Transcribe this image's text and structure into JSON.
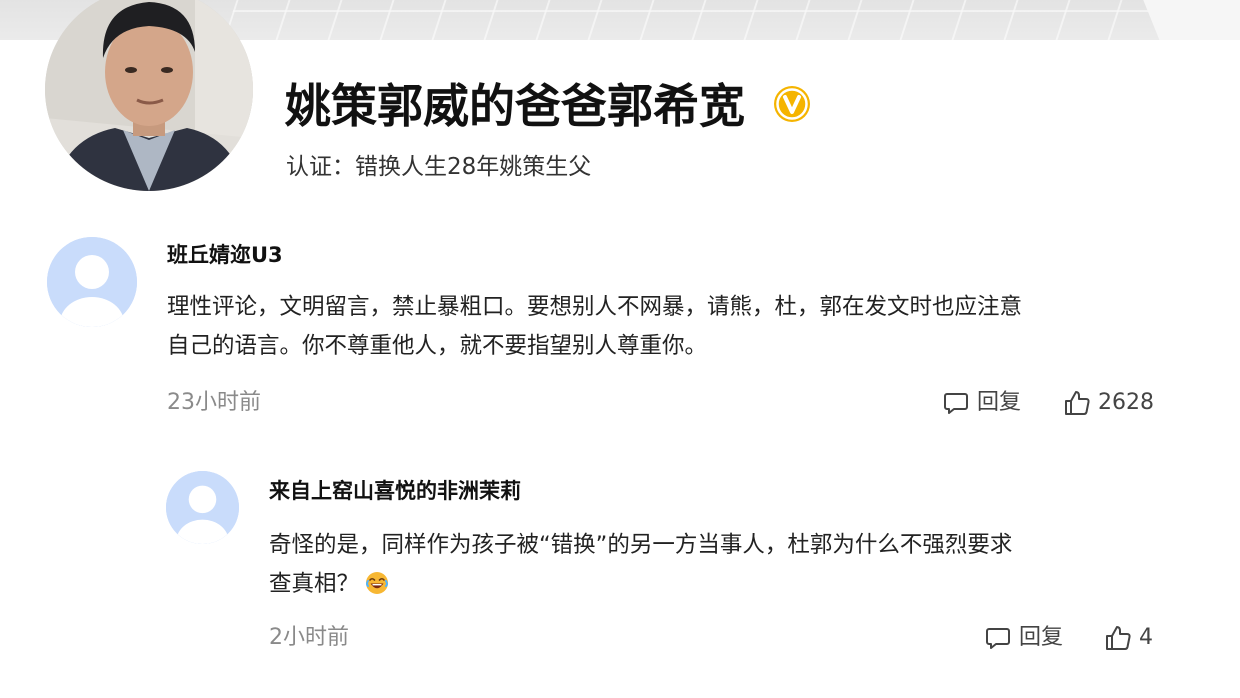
{
  "profile": {
    "name": "姚策郭威的爸爸郭希宽",
    "verification_prefix": "认证：",
    "verification_text": "错换人生28年姚策生父"
  },
  "comments": [
    {
      "username": "班丘婧迩U3",
      "text_lines": [
        "理性评论，文明留言，禁止暴粗口。要想别人不网暴，请熊，杜，郭在发文时也应注意",
        "自己的语言。你不尊重他人，就不要指望别人尊重你。"
      ],
      "time": "23小时前",
      "reply_label": "回复",
      "likes": "2628"
    },
    {
      "username": "来自上窑山喜悦的非洲茉莉",
      "text_lines": [
        "奇怪的是，同样作为孩子被“错换”的另一方当事人，杜郭为什么不强烈要求",
        "查真相？"
      ],
      "emoji": "laughing-crying-face",
      "time": "2小时前",
      "reply_label": "回复",
      "likes": "4"
    }
  ],
  "colors": {
    "verified_badge": "#f5b400",
    "avatar_placeholder_bg": "#c9dcfb",
    "avatar_placeholder_fg": "#ffffff",
    "muted_text": "#8a8a8a"
  }
}
